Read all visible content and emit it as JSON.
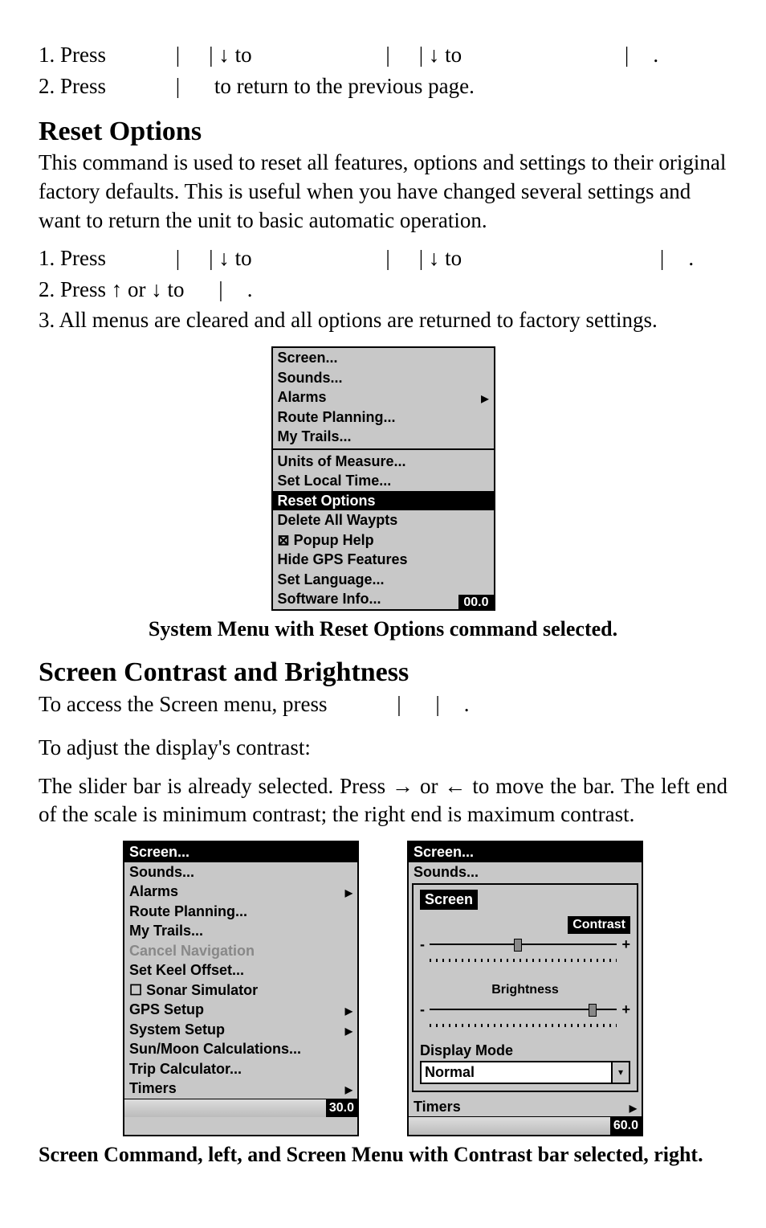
{
  "lines": {
    "l1_press": "1. Press",
    "l1_to1": "to",
    "l1_to2": "to",
    "l2_press": "2. Press",
    "l2_rest": "to return to the previous page.",
    "r_l1_press": "1. Press",
    "r_l1_to1": "to",
    "r_l1_to2": "to",
    "r_l2": "2. Press ",
    "r_l2_mid": " or ",
    "r_l2_to": " to",
    "r_l3": "3. All menus are cleared and all options are returned to factory settings."
  },
  "sections": {
    "reset_title": "Reset Options",
    "reset_para": "This command is used to reset all features, options and settings to their original factory defaults. This is useful when you have changed several settings and want to return the unit to basic automatic operation.",
    "screen_title": "Screen Contrast and Brightness",
    "screen_access": "To access the Screen menu, press",
    "screen_adjust_intro": "To adjust the display's contrast:",
    "screen_adjust_para1_a": "The",
    "screen_adjust_para1_b": "slider bar is already selected. Press ",
    "screen_adjust_para1_c": " or ",
    "screen_adjust_para1_d": " to move the bar. The left end of the scale is minimum contrast; the right end is maximum contrast."
  },
  "captions": {
    "cap1": "System Menu with Reset Options command selected.",
    "cap2": "Screen Command, left, and Screen Menu with Contrast bar selected, right."
  },
  "menu1": {
    "items": [
      "Screen...",
      "Sounds...",
      "Alarms",
      "Route Planning...",
      "My Trails...",
      "Units of Measure...",
      "Set Local Time...",
      "Reset Options",
      "Delete All Waypts",
      "⊠ Popup Help",
      "Hide GPS Features",
      "Set Language...",
      "Software Info..."
    ],
    "badge": "00.0"
  },
  "menu2_left": {
    "items": [
      "Screen...",
      "Sounds...",
      "Alarms",
      "Route Planning...",
      "My Trails...",
      "Cancel Navigation",
      "Set Keel Offset...",
      "☐ Sonar Simulator",
      "GPS Setup",
      "System Setup",
      "Sun/Moon Calculations...",
      "Trip Calculator...",
      "Timers"
    ],
    "footer": "30.0"
  },
  "menu2_right": {
    "top": [
      "Screen...",
      "Sounds..."
    ],
    "panel_title": "Screen",
    "contrast_label": "Contrast",
    "brightness_label": "Brightness",
    "display_mode_label": "Display Mode",
    "display_mode_value": "Normal",
    "bottom": "Timers",
    "footer": "60.0"
  }
}
